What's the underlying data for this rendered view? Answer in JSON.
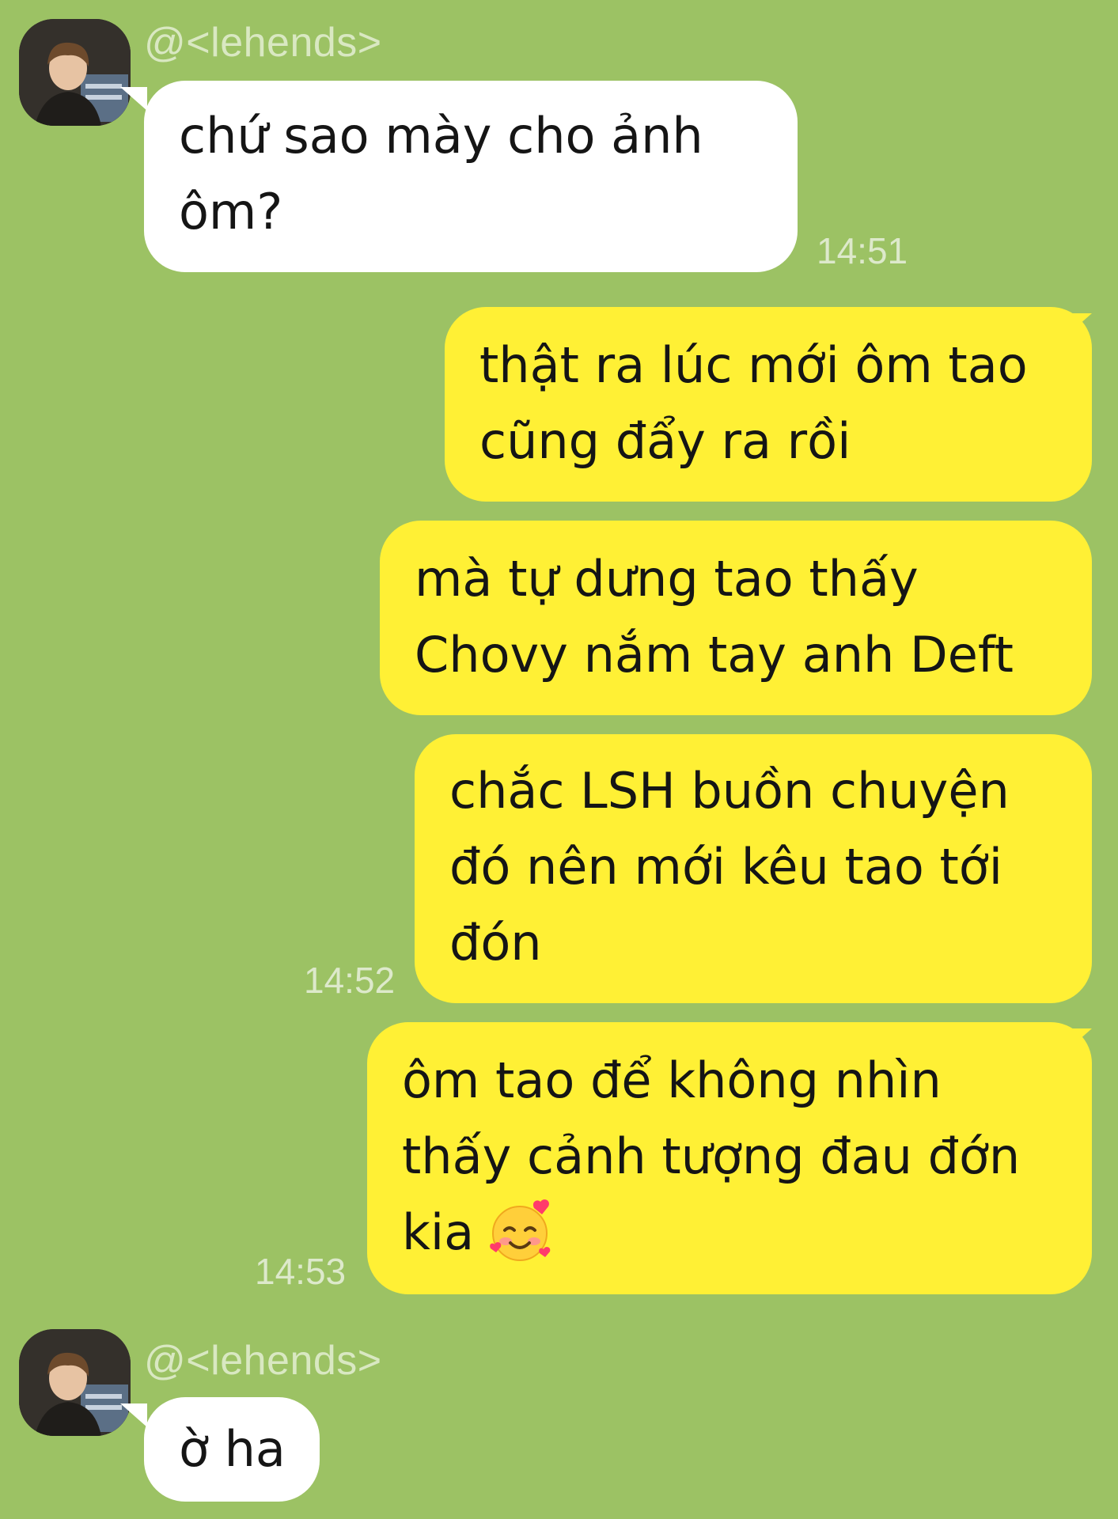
{
  "theme": {
    "background": "#9cc264",
    "incoming_bubble": "#ffffff",
    "outgoing_bubble": "#fff035",
    "meta_text": "#dde9cb"
  },
  "messages": [
    {
      "direction": "incoming",
      "sender": "@<lehends>",
      "lines": [
        "chứ sao mày cho ảnh",
        "ôm?"
      ],
      "time": "14:51"
    },
    {
      "direction": "outgoing",
      "lines": [
        "thật ra lúc mới ôm tao",
        "cũng đẩy ra rồi"
      ]
    },
    {
      "direction": "outgoing",
      "lines": [
        "mà tự dưng tao thấy",
        "Chovy nắm tay anh Deft"
      ]
    },
    {
      "direction": "outgoing",
      "lines": [
        "chắc LSH buồn chuyện",
        "đó nên mới kêu tao tới",
        "đón"
      ],
      "time": "14:52"
    },
    {
      "direction": "outgoing",
      "lines": [
        "ôm tao để không nhìn",
        "thấy cảnh tượng đau đớn",
        "kia"
      ],
      "emoji": "smiling-face-with-hearts-emoji",
      "time": "14:53"
    },
    {
      "direction": "incoming",
      "sender": "@<lehends>",
      "lines": [
        "ờ ha"
      ]
    }
  ]
}
